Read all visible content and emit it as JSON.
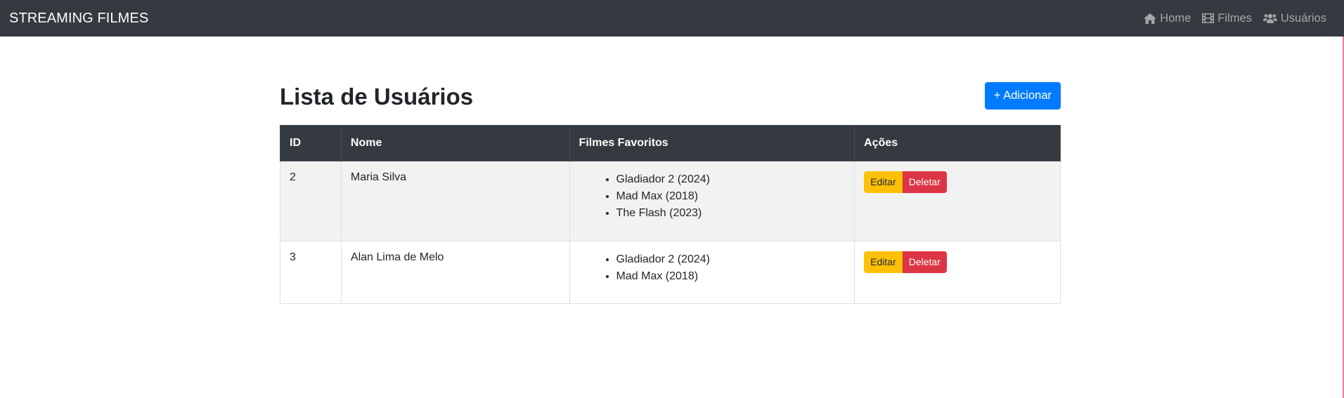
{
  "navbar": {
    "brand": "STREAMING FILMES",
    "links": [
      {
        "label": "Home",
        "icon": "home-icon"
      },
      {
        "label": "Filmes",
        "icon": "film-icon"
      },
      {
        "label": "Usuários",
        "icon": "users-icon"
      }
    ]
  },
  "page": {
    "title": "Lista de Usuários",
    "add_button": "+ Adicionar"
  },
  "table": {
    "headers": [
      "ID",
      "Nome",
      "Filmes Favoritos",
      "Ações"
    ],
    "rows": [
      {
        "id": "2",
        "nome": "Maria Silva",
        "filmes": [
          "Gladiador 2 (2024)",
          "Mad Max (2018)",
          "The Flash (2023)"
        ],
        "edit": "Editar",
        "delete": "Deletar"
      },
      {
        "id": "3",
        "nome": "Alan Lima de Melo",
        "filmes": [
          "Gladiador 2 (2024)",
          "Mad Max (2018)"
        ],
        "edit": "Editar",
        "delete": "Deletar"
      }
    ]
  },
  "colors": {
    "navbar_bg": "#343a40",
    "primary": "#007bff",
    "warning": "#ffc107",
    "danger": "#dc3545"
  }
}
